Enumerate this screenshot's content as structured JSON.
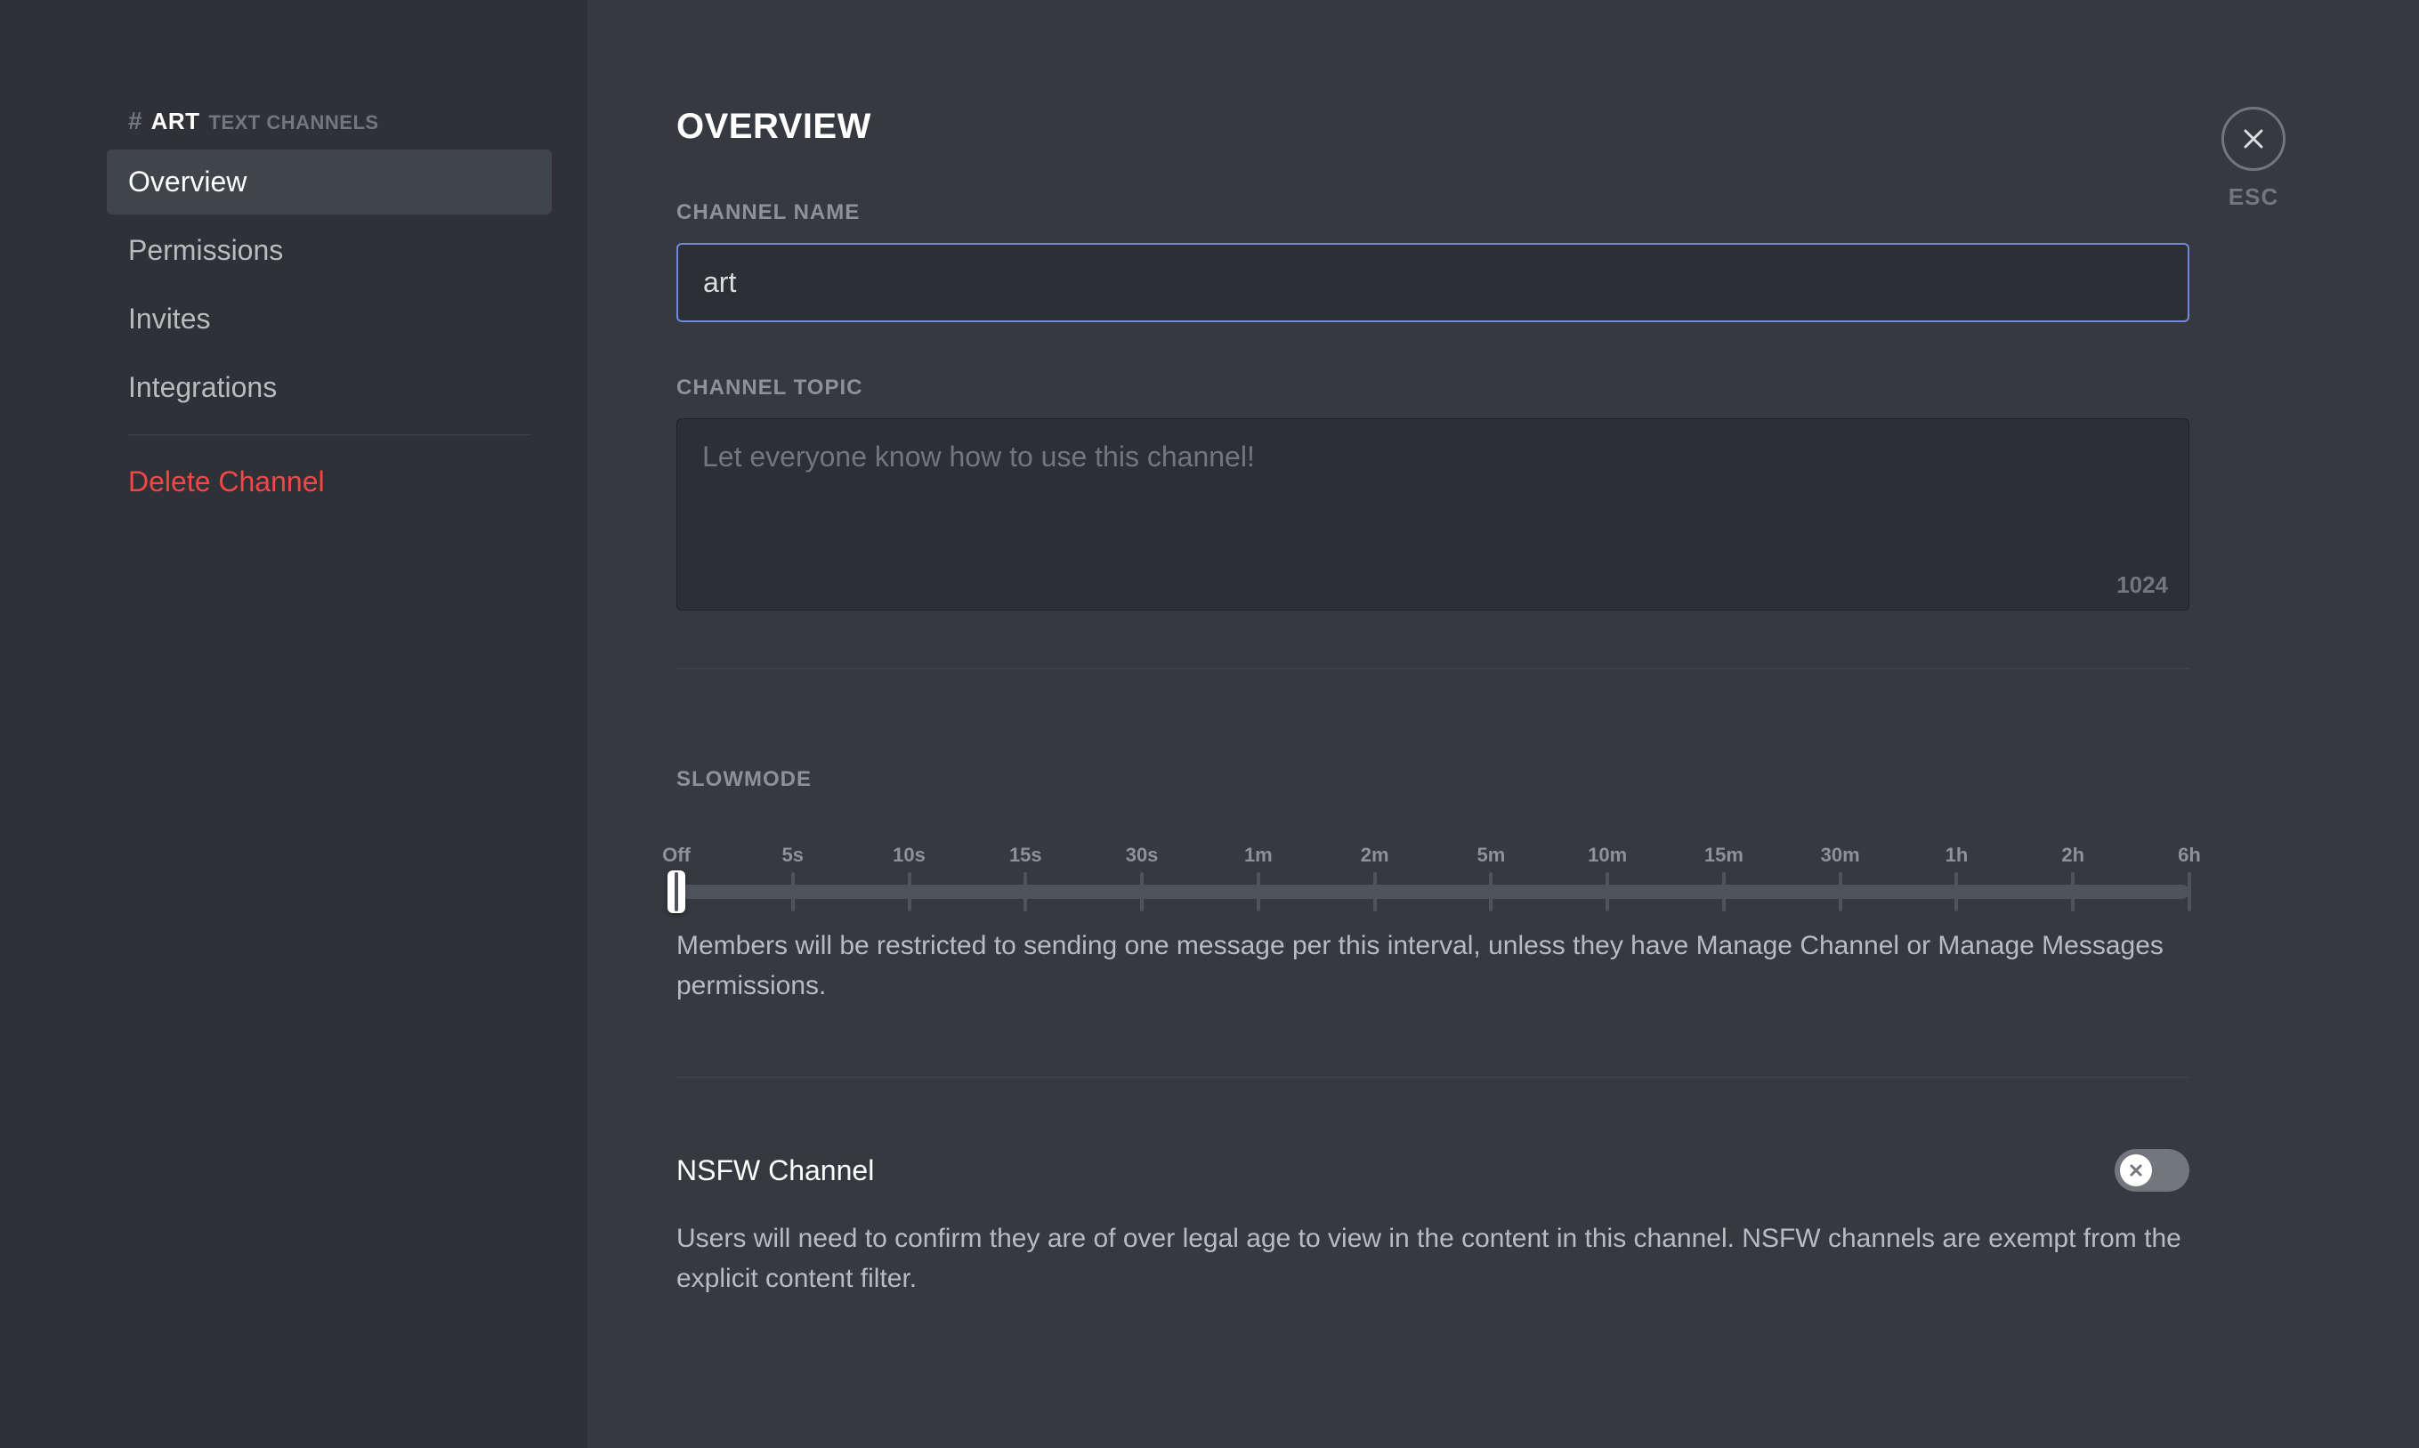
{
  "sidebar": {
    "channel_prefix": "#",
    "channel_name": "ART",
    "channel_category": "TEXT CHANNELS",
    "items": [
      {
        "label": "Overview",
        "active": true
      },
      {
        "label": "Permissions",
        "active": false
      },
      {
        "label": "Invites",
        "active": false
      },
      {
        "label": "Integrations",
        "active": false
      }
    ],
    "delete_label": "Delete Channel"
  },
  "main": {
    "title": "OVERVIEW",
    "channel_name_label": "CHANNEL NAME",
    "channel_name_value": "art",
    "channel_topic_label": "CHANNEL TOPIC",
    "channel_topic_placeholder": "Let everyone know how to use this channel!",
    "channel_topic_char_count": "1024",
    "slowmode_label": "SLOWMODE",
    "slowmode_ticks": [
      "Off",
      "5s",
      "10s",
      "15s",
      "30s",
      "1m",
      "2m",
      "5m",
      "10m",
      "15m",
      "30m",
      "1h",
      "2h",
      "6h"
    ],
    "slowmode_description": "Members will be restricted to sending one message per this interval, unless they have Manage Channel or Manage Messages permissions.",
    "nsfw_label": "NSFW Channel",
    "nsfw_description": "Users will need to confirm they are of over legal age to view in the content in this channel. NSFW channels are exempt from the explicit content filter.",
    "nsfw_enabled": false
  },
  "close": {
    "esc_label": "ESC"
  }
}
